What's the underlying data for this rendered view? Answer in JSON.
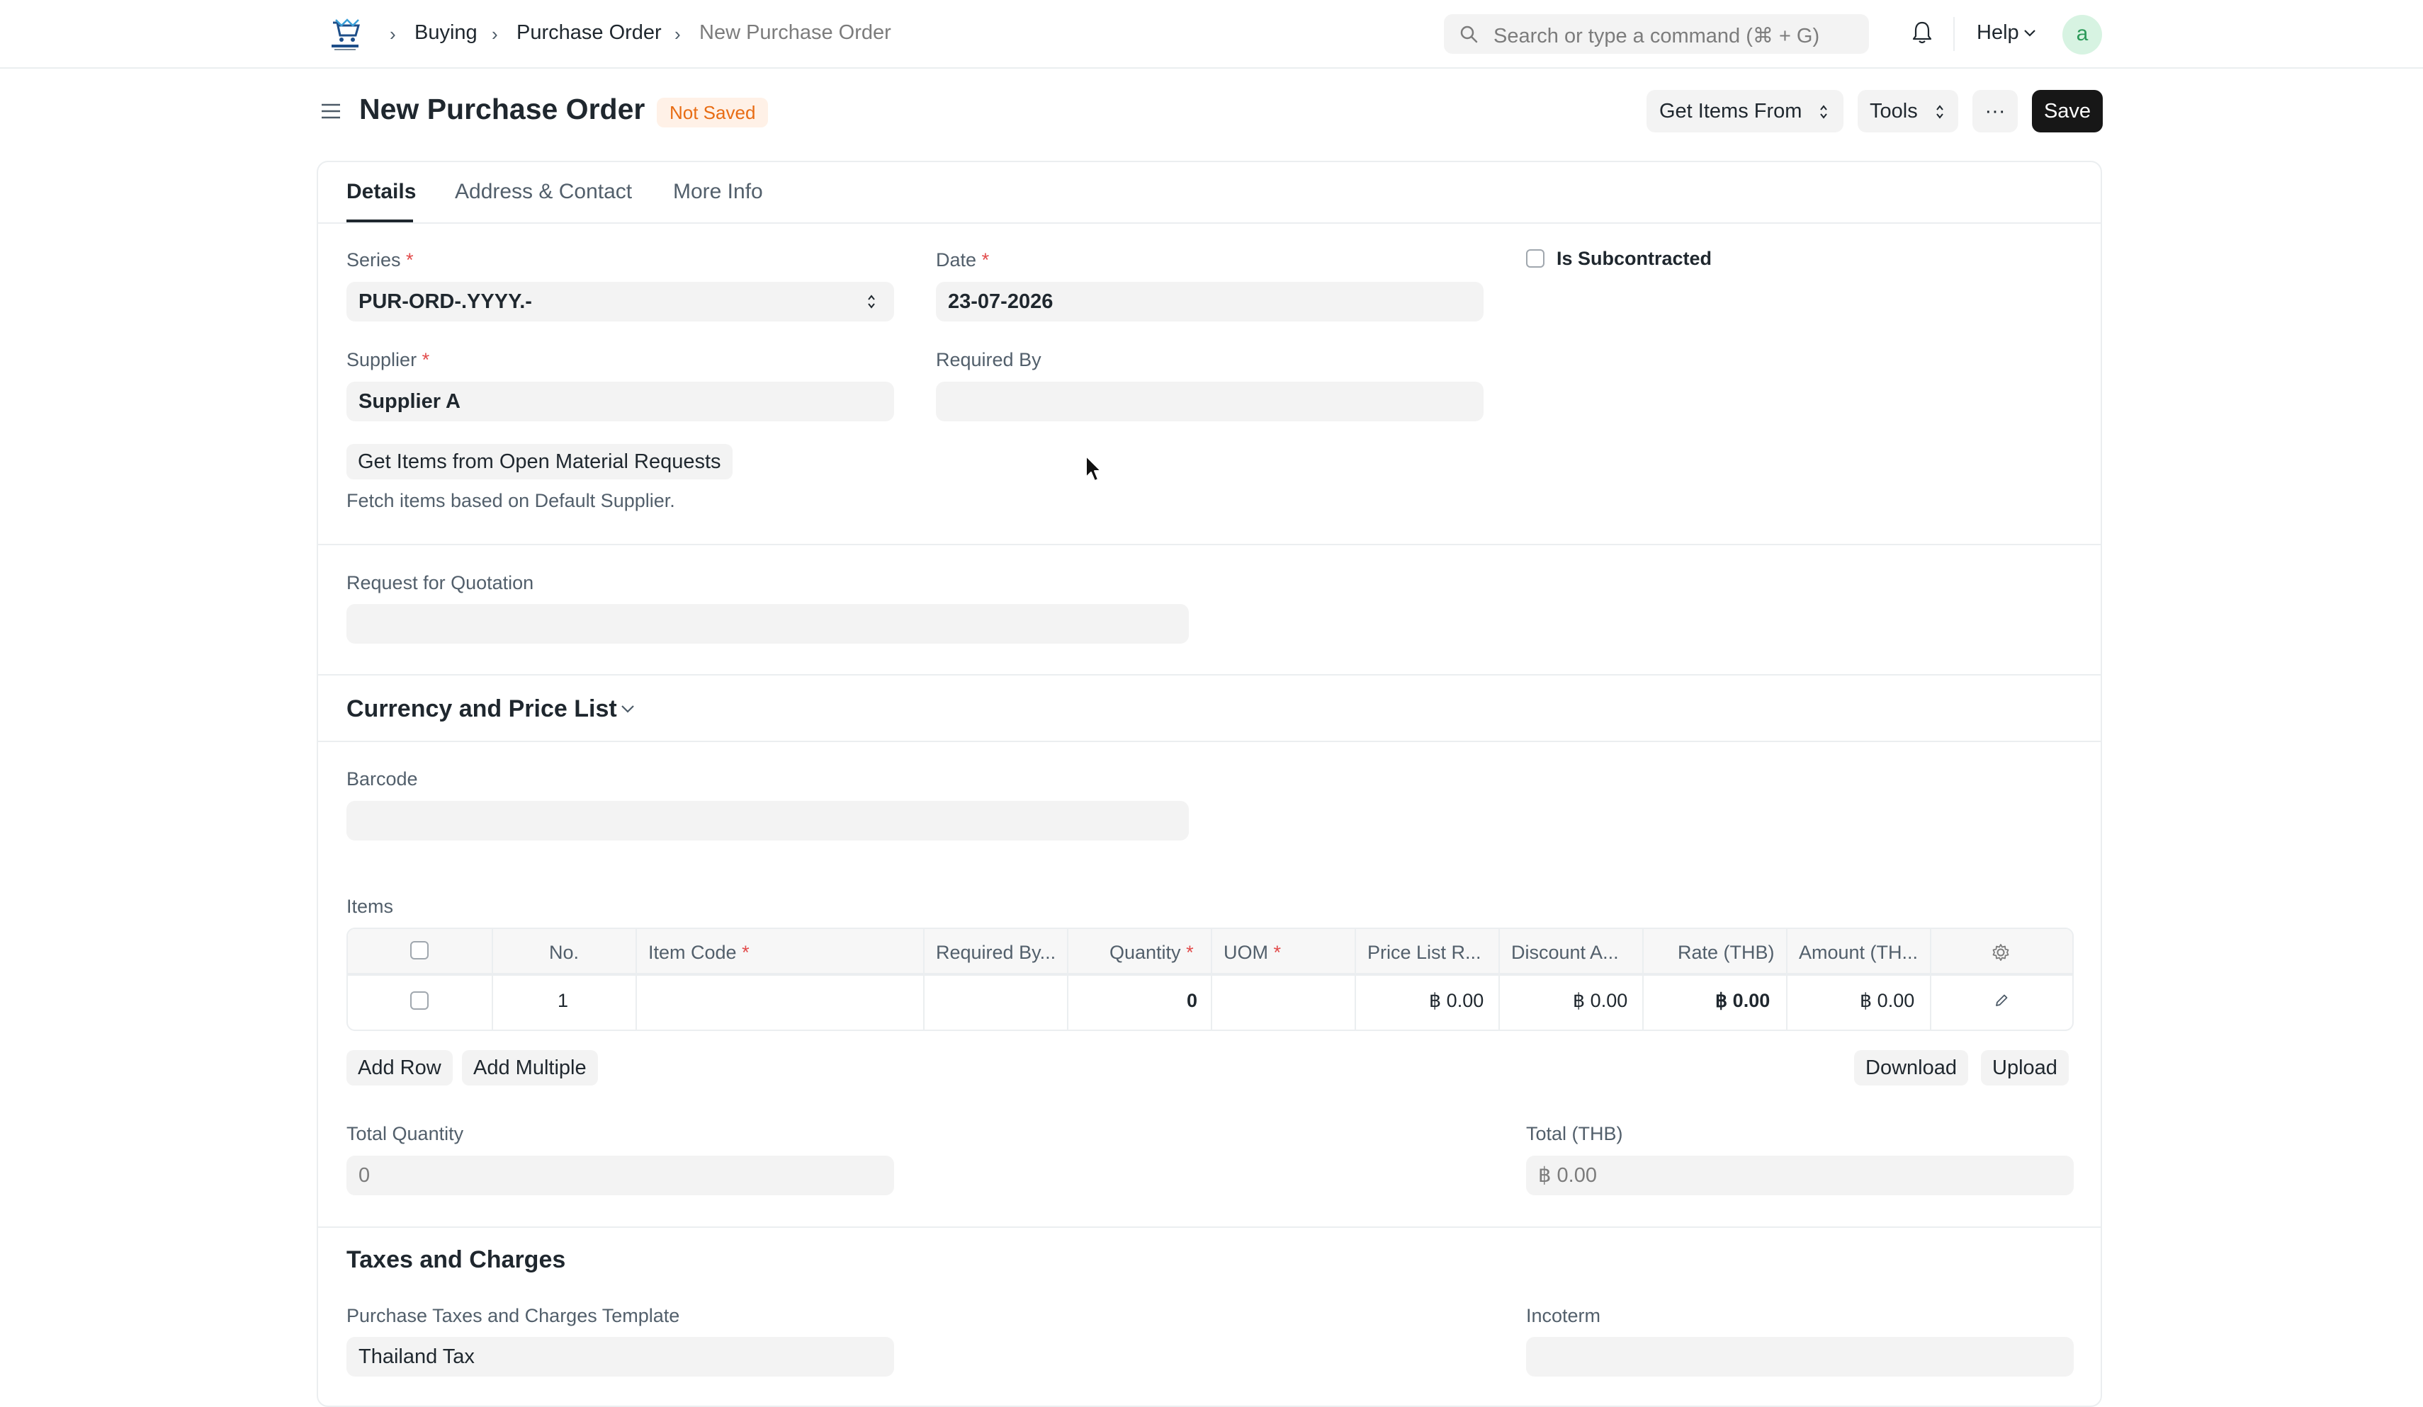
{
  "navbar": {
    "logo_name": "company-logo",
    "breadcrumbs": [
      "Buying",
      "Purchase Order",
      "New Purchase Order"
    ],
    "search_placeholder": "Search or type a command (⌘ + G)",
    "help_label": "Help",
    "avatar_letter": "a"
  },
  "page": {
    "title": "New Purchase Order",
    "status_badge": "Not Saved",
    "get_items_from_label": "Get Items From",
    "tools_label": "Tools",
    "more_label": "···",
    "save_label": "Save"
  },
  "tabs": [
    {
      "label": "Details",
      "active": true
    },
    {
      "label": "Address & Contact",
      "active": false
    },
    {
      "label": "More Info",
      "active": false
    }
  ],
  "form": {
    "series": {
      "label": "Series",
      "value": "PUR-ORD-.YYYY.-"
    },
    "date": {
      "label": "Date",
      "value": "23-07-2026"
    },
    "is_subcontracted": {
      "label": "Is Subcontracted",
      "checked": false
    },
    "supplier": {
      "label": "Supplier",
      "value": "Supplier A"
    },
    "required_by": {
      "label": "Required By",
      "value": ""
    },
    "get_items_button": "Get Items from Open Material Requests",
    "fetch_desc": "Fetch items based on Default Supplier.",
    "rfq": {
      "label": "Request for Quotation",
      "value": ""
    },
    "currency_section": "Currency and Price List",
    "barcode": {
      "label": "Barcode",
      "value": ""
    },
    "items_label": "Items",
    "items_table": {
      "columns": [
        "No.",
        "Item Code",
        "Required By...",
        "Quantity",
        "UOM",
        "Price List R...",
        "Discount A...",
        "Rate (THB)",
        "Amount (TH..."
      ],
      "required_columns": [
        "Item Code",
        "Quantity",
        "UOM"
      ],
      "rows": [
        {
          "no": "1",
          "item_code": "",
          "required_by": "",
          "quantity": "0",
          "uom": "",
          "price_list_rate": "฿ 0.00",
          "discount_amount": "฿ 0.00",
          "rate": "฿ 0.00",
          "amount": "฿ 0.00"
        }
      ]
    },
    "add_row": "Add Row",
    "add_multiple": "Add Multiple",
    "download": "Download",
    "upload": "Upload",
    "total_quantity": {
      "label": "Total Quantity",
      "value": "0"
    },
    "total_thb": {
      "label": "Total (THB)",
      "value": "฿ 0.00"
    },
    "taxes_section": "Taxes and Charges",
    "taxes_template": {
      "label": "Purchase Taxes and Charges Template",
      "value": "Thailand Tax"
    },
    "incoterm": {
      "label": "Incoterm",
      "value": ""
    }
  },
  "colors": {
    "accent_dark": "#171717",
    "badge_text": "#e86c13",
    "badge_bg": "#fff1e7",
    "required_star": "#e24c4c",
    "avatar_bg": "#d7f3e2"
  }
}
